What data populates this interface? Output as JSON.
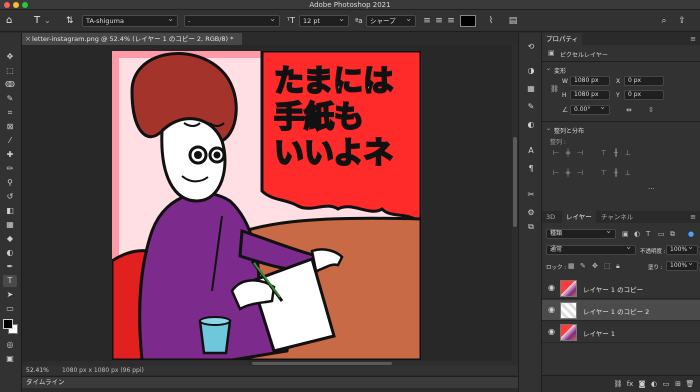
{
  "window": {
    "title": "Adobe Photoshop 2021"
  },
  "options_bar": {
    "tool_icon": "type-tool-icon",
    "orientation_icon": "text-orientation-icon",
    "font_family": "TA-shiguma",
    "font_style": "-",
    "size_icon": "font-size-icon",
    "font_size": "12 pt",
    "antialias_icon": "antialias-icon",
    "antialias": "シャープ",
    "text_color": "#000000"
  },
  "document": {
    "tab_title": "letter-instagram.png @ 52.4% (レイヤー 1 のコピー 2, RGB/8) *",
    "zoom": "52.41%",
    "info": "1080 px x 1080 px (96 ppi)",
    "artwork_text": [
      "たまには",
      "手紙も",
      "いいよネ"
    ]
  },
  "timeline": {
    "label": "タイムライン"
  },
  "properties": {
    "tab": "プロパティ",
    "layer_kind": "ピクセルレイヤー",
    "transform_heading": "変形",
    "w_label": "W",
    "w_value": "1080 px",
    "x_label": "X",
    "x_value": "0 px",
    "h_label": "H",
    "h_value": "1080 px",
    "y_label": "Y",
    "y_value": "0 px",
    "angle": "0.00°",
    "align_heading": "整列と分布",
    "align_label": "整列 :"
  },
  "layers_panel": {
    "tabs": [
      "3D",
      "レイヤー",
      "チャンネル"
    ],
    "active_tab": 1,
    "filter_kind": "種類",
    "blend_mode": "通常",
    "opacity_label": "不透明度 :",
    "opacity_value": "100%",
    "lock_label": "ロック :",
    "fill_label": "塗り :",
    "fill_value": "100%",
    "layers": [
      {
        "name": "レイヤー 1 のコピー",
        "selected": false,
        "visible": true
      },
      {
        "name": "レイヤー 1 のコピー 2",
        "selected": true,
        "visible": true
      },
      {
        "name": "レイヤー 1",
        "selected": false,
        "visible": true
      }
    ]
  }
}
